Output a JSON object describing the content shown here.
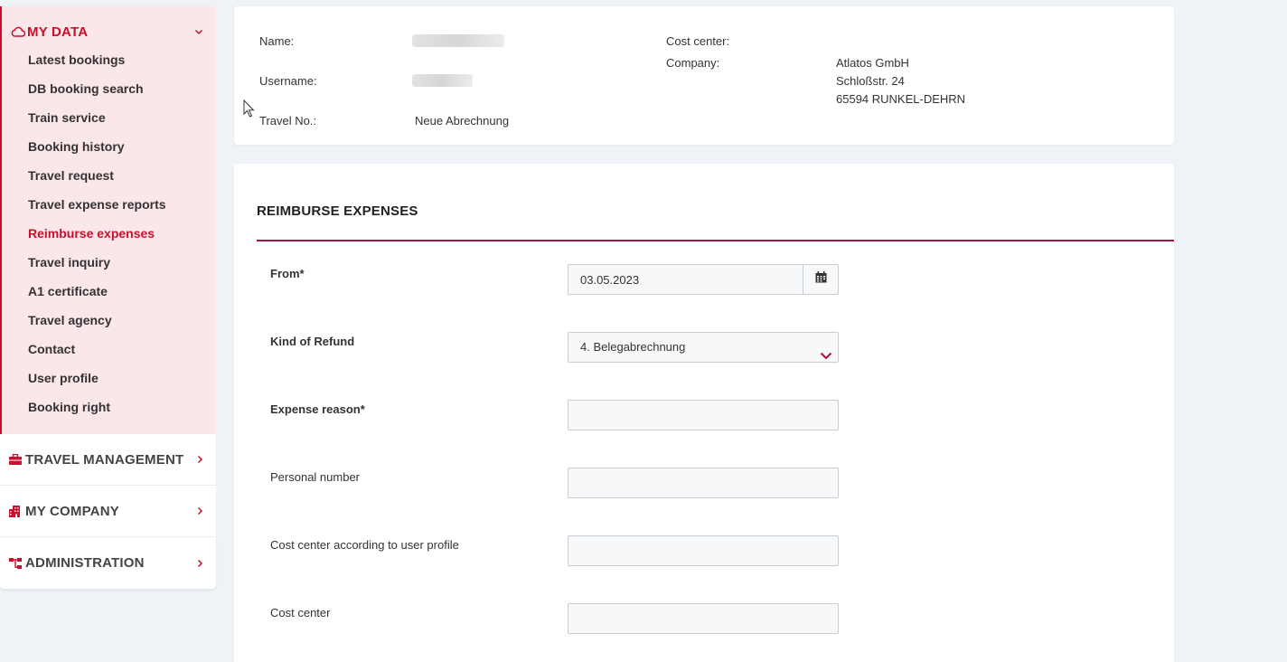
{
  "sidebar": {
    "my_data": {
      "title": "MY DATA",
      "items": [
        {
          "label": "Latest bookings"
        },
        {
          "label": "DB booking search"
        },
        {
          "label": "Train service"
        },
        {
          "label": "Booking history"
        },
        {
          "label": "Travel request"
        },
        {
          "label": "Travel expense reports"
        },
        {
          "label": "Reimburse expenses",
          "active": true
        },
        {
          "label": "Travel inquiry"
        },
        {
          "label": "A1 certificate"
        },
        {
          "label": "Travel agency"
        },
        {
          "label": "Contact"
        },
        {
          "label": "User profile"
        },
        {
          "label": "Booking right"
        }
      ]
    },
    "travel_management": {
      "title": "TRAVEL MANAGEMENT"
    },
    "my_company": {
      "title": "MY COMPANY"
    },
    "administration": {
      "title": "ADMINISTRATION"
    }
  },
  "info": {
    "name_label": "Name:",
    "username_label": "Username:",
    "travel_no_label": "Travel No.:",
    "travel_no_value": "Neue Abrechnung",
    "cost_center_label": "Cost center:",
    "company_label": "Company:",
    "company_name": "Atlatos GmbH",
    "company_street": "Schloßstr. 24",
    "company_city": "65594 RUNKEL-DEHRN"
  },
  "form": {
    "title": "REIMBURSE EXPENSES",
    "from_label": "From*",
    "from_value": "03.05.2023",
    "kind_label": "Kind of Refund",
    "kind_value": "4. Belegabrechnung",
    "reason_label": "Expense reason*",
    "reason_value": "",
    "personal_label": "Personal number",
    "personal_value": "",
    "cc_profile_label": "Cost center according to user profile",
    "cc_profile_value": "",
    "cc_label": "Cost center",
    "cc_value": ""
  },
  "colors": {
    "accent": "#c8102e",
    "sidebar_open_bg": "#fbe6e9",
    "page_bg": "#eff2f6",
    "rule": "#a8123e"
  },
  "icons": {
    "my_data": "cloud-icon",
    "travel_management": "briefcase-icon",
    "my_company": "building-icon",
    "administration": "sitemap-icon",
    "date": "calendar-icon"
  }
}
